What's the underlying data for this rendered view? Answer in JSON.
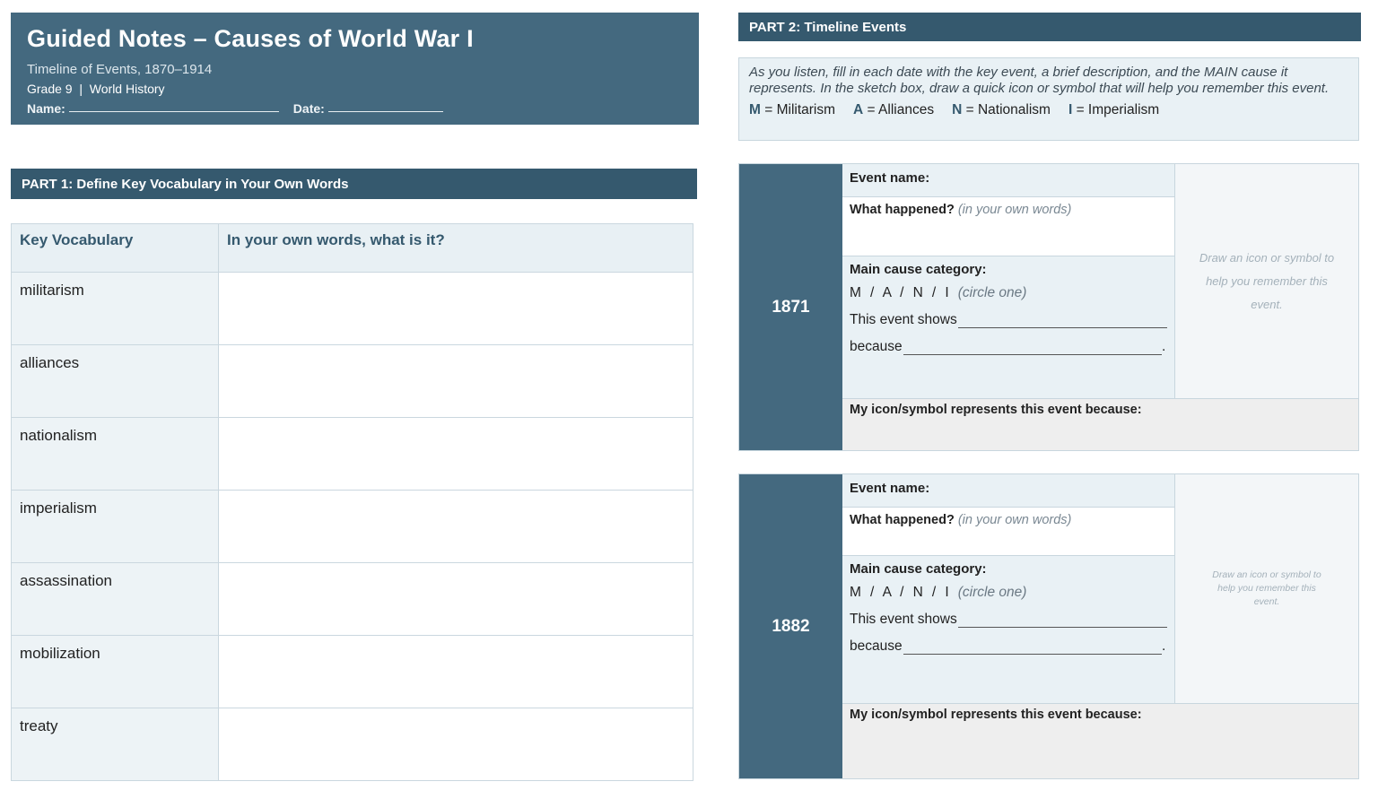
{
  "header": {
    "title": "Guided Notes – Causes of World War I",
    "subtitle": "Timeline of Events, 1870–1914",
    "grade": "Grade 9  |  World History",
    "name_label": "Name:",
    "date_label": "Date:"
  },
  "part1": {
    "title": "PART 1: Define Key Vocabulary in Your Own Words",
    "col1": "Key Vocabulary",
    "col2": "In your own words, what is it?",
    "terms": [
      "militarism",
      "alliances",
      "nationalism",
      "imperialism",
      "assassination",
      "mobilization",
      "treaty"
    ]
  },
  "part2": {
    "title": "PART 2: Timeline Events",
    "instructions": "As you listen, fill in each date with the key event, a brief description, and the MAIN cause it represents. In the sketch box, draw a quick icon or symbol that will help you remember this event.",
    "legend": [
      {
        "key": "M",
        "label": "= Militarism"
      },
      {
        "key": "A",
        "label": "= Alliances"
      },
      {
        "key": "N",
        "label": "= Nationalism"
      },
      {
        "key": "I",
        "label": "= Imperialism"
      }
    ],
    "labels": {
      "event_name": "Event name:",
      "what_happened": "What happened?",
      "what_hint": "(in your own words)",
      "main_cause": "Main cause category:",
      "mani": "M  /  A  /  N  /  I",
      "circle_hint": "(circle one)",
      "shows": "This event shows",
      "because": "because",
      "icon_reason": "My icon/symbol represents this event because:",
      "sketch": "Draw an icon or symbol to help you remember this event."
    },
    "events": [
      {
        "year": "1871"
      },
      {
        "year": "1882"
      }
    ]
  }
}
